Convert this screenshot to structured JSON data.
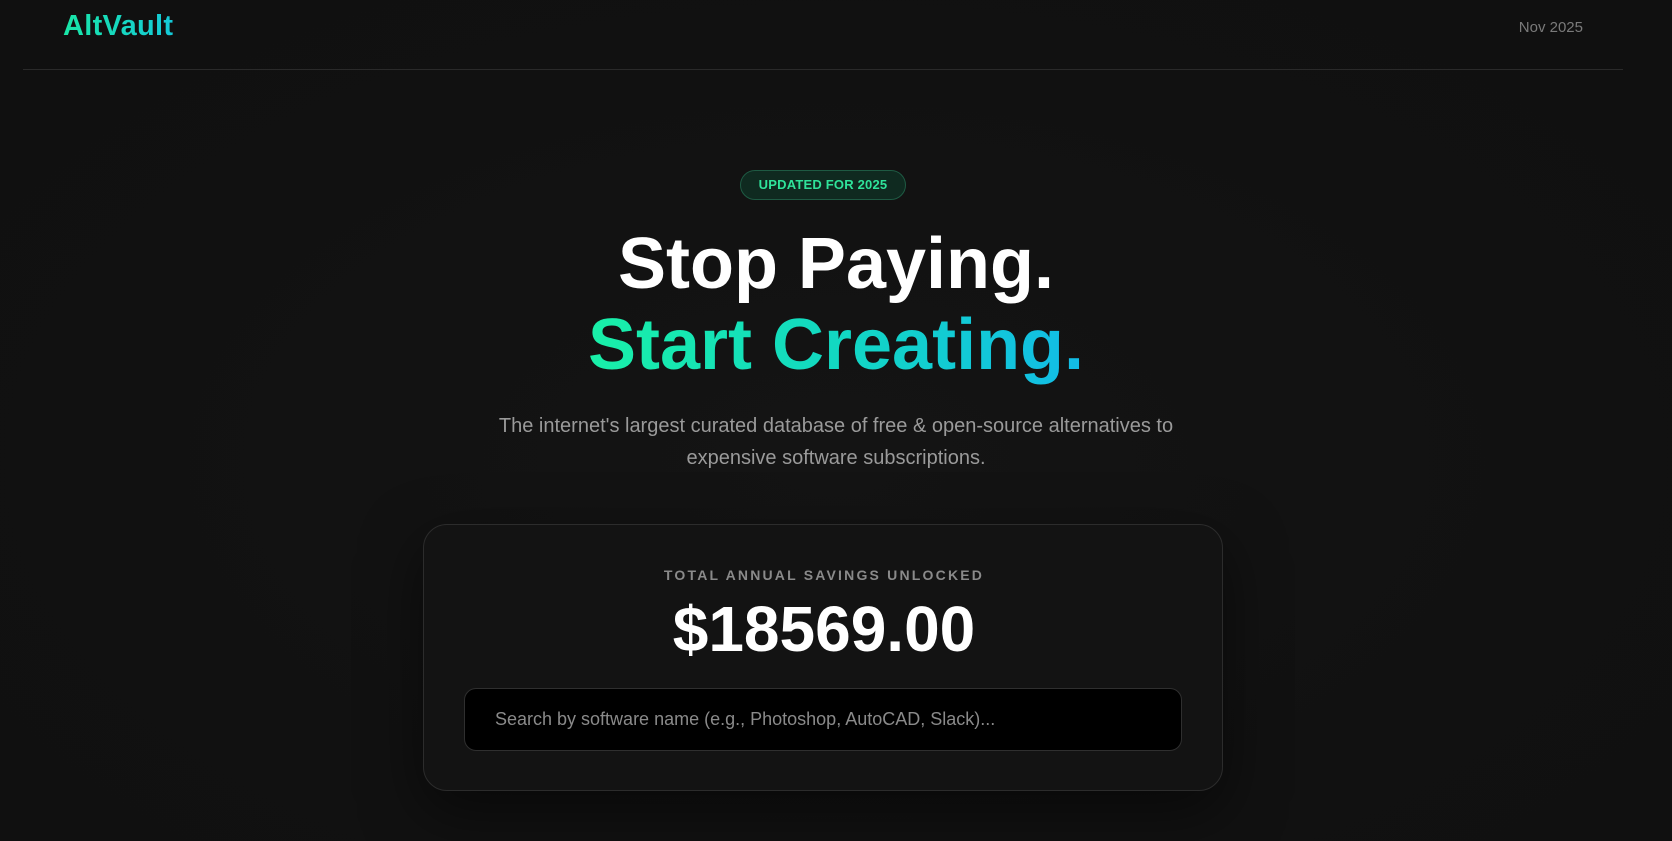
{
  "header": {
    "logo": "AltVault",
    "date": "Nov 2025"
  },
  "hero": {
    "badge": "UPDATED FOR 2025",
    "headline_line1": "Stop Paying.",
    "headline_line2": "Start Creating.",
    "subtitle": "The internet's largest curated database of free & open-source alternatives to expensive software subscriptions."
  },
  "savings": {
    "label": "TOTAL ANNUAL SAVINGS UNLOCKED",
    "value": "$18569.00"
  },
  "search": {
    "value": "",
    "placeholder": "Search by software name (e.g., Photoshop, AutoCAD, Slack)..."
  },
  "colors": {
    "accent_green": "#19e6a6",
    "accent_cyan": "#12bce8",
    "background": "#121212"
  }
}
